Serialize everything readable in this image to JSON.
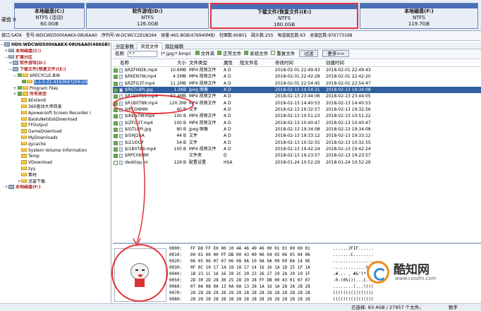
{
  "disk": {
    "label": "硬盘 0"
  },
  "partitions": [
    {
      "name": "本地磁盘(C:)",
      "fs": "NTFS (活动)",
      "size": "60.0GB",
      "selected": false
    },
    {
      "name": "软件游戏(D:)",
      "fs": "NTFS",
      "size": "126.0GB",
      "selected": false
    },
    {
      "name": "下载文件(恢复文件)(E:)",
      "fs": "NTFS",
      "size": "160.0GB",
      "selected": true
    },
    {
      "name": "本地磁盘(F:)",
      "fs": "NTFS",
      "size": "119.7GB",
      "selected": false
    }
  ],
  "info": [
    "接口:SATA",
    "型号:WDCWD5000AAKX-08U6AA0",
    "序列号:W-DCWCC2EU8264",
    "容量:465.8GB(476940MB)",
    "柱面数:60801",
    "磁头数:255",
    "每道扇区数:63",
    "总扇区数:976773168"
  ],
  "tree": [
    {
      "label": "HD0:WDCWD5000AAKX-08U6AA0(466GB)",
      "expander": "-",
      "checkbox": false,
      "icon": "drive",
      "style": "bold"
    },
    {
      "label": "本地磁盘(C:)",
      "expander": "+",
      "checkbox": false,
      "icon": "drive",
      "style": "red"
    },
    {
      "label": "扩展分区",
      "expander": "-",
      "checkbox": false,
      "icon": "drive",
      "style": "red"
    },
    {
      "label": "软件游戏(D:)",
      "expander": "+",
      "checkbox": false,
      "icon": "drive",
      "style": "red"
    },
    {
      "label": "下载文件(恢复文件)(E:)",
      "expander": "-",
      "checkbox": false,
      "icon": "drive",
      "style": "red"
    },
    {
      "label": "$RECYCLE.BIN",
      "expander": "-",
      "checkbox": true,
      "icon": "folder",
      "style": ""
    },
    {
      "label": "S-1-5-21-4163647256-24",
      "expander": "",
      "checkbox": true,
      "icon": "folder",
      "style": "hl"
    },
    {
      "label": "Program Files",
      "expander": "+",
      "checkbox": true,
      "icon": "folder",
      "style": ""
    },
    {
      "label": "所有类型",
      "expander": "+",
      "checkbox": true,
      "icon": "folder",
      "style": "red"
    },
    {
      "label": "$Extend",
      "expander": "",
      "checkbox": false,
      "icon": "folder",
      "style": ""
    },
    {
      "label": "360驱动大师目录",
      "expander": "",
      "checkbox": false,
      "icon": "folder",
      "style": ""
    },
    {
      "label": "Apowersoft Screen Recorder I",
      "expander": "",
      "checkbox": false,
      "icon": "folder",
      "style": ""
    },
    {
      "label": "BaiduNetdiskDownload",
      "expander": "",
      "checkbox": false,
      "icon": "folder",
      "style": ""
    },
    {
      "label": "FFOutput",
      "expander": "",
      "checkbox": false,
      "icon": "folder",
      "style": ""
    },
    {
      "label": "GameDownload",
      "expander": "",
      "checkbox": false,
      "icon": "folder",
      "style": ""
    },
    {
      "label": "MyDownloads",
      "expander": "",
      "checkbox": false,
      "icon": "folder",
      "style": ""
    },
    {
      "label": "qycache",
      "expander": "",
      "checkbox": false,
      "icon": "folder",
      "style": ""
    },
    {
      "label": "System Volume Information",
      "expander": "",
      "checkbox": false,
      "icon": "folder",
      "style": ""
    },
    {
      "label": "Temp",
      "expander": "",
      "checkbox": false,
      "icon": "folder",
      "style": ""
    },
    {
      "label": "VDownload",
      "expander": "",
      "checkbox": false,
      "icon": "folder",
      "style": ""
    },
    {
      "label": "zyy",
      "expander": "",
      "checkbox": false,
      "icon": "folder",
      "style": ""
    },
    {
      "label": "素材",
      "expander": "",
      "checkbox": false,
      "icon": "folder",
      "style": ""
    },
    {
      "label": "迅雷下载",
      "expander": "+",
      "checkbox": false,
      "icon": "folder",
      "style": ""
    },
    {
      "label": "本地磁盘(F:)",
      "expander": "+",
      "checkbox": false,
      "icon": "drive",
      "style": "red"
    }
  ],
  "tabs": [
    "分区参数",
    "浏览文件",
    "扇区编辑"
  ],
  "filter": {
    "name_label": "名称",
    "pattern": "*.*",
    "hint": "(*.jpg;*.bmp)",
    "checks": [
      {
        "label": "文件夹",
        "on": true
      },
      {
        "label": "正常文件",
        "on": true
      },
      {
        "label": "系统文件",
        "on": true
      },
      {
        "label": "重复文件",
        "on": false
      }
    ],
    "filter_btn": "过滤",
    "more_btn": "更多>>"
  },
  "columns": {
    "name": "名称",
    "size": "大小",
    "type": "文件类型",
    "attr": "属性",
    "short": "短文件名",
    "modified": "修改时间",
    "created": "创建时间"
  },
  "files": [
    {
      "name": "$RZFHIDK.mp4",
      "size": "10.6MB",
      "type": "MP4 视频文件",
      "attr": "A D",
      "short": "",
      "modified": "2018-02-01 22:49:43",
      "created": "2018-02-01 22:49:43",
      "checked": true,
      "selected": false
    },
    {
      "name": "$RKEN7W.mp4",
      "size": "4.5MB",
      "type": "MP4 视频文件",
      "attr": "A D",
      "short": "",
      "modified": "2018-02-01 22:42:28",
      "created": "2018-02-01 22:42:20",
      "checked": true,
      "selected": false
    },
    {
      "name": "$RZFG3T.mp4",
      "size": "11.1MB",
      "type": "MP4 视频文件",
      "attr": "A D",
      "short": "",
      "modified": "2018-02-01 22:54:45",
      "created": "2018-02-01 22:54:47",
      "checked": true,
      "selected": false
    },
    {
      "name": "$RGTL8PI.jpg",
      "size": "1.2KB",
      "type": "Jpeg 图像",
      "attr": "A D",
      "short": "",
      "modified": "2018-02-13 10:54:31",
      "created": "2018-02-13 19:34:08",
      "checked": true,
      "selected": true
    },
    {
      "name": "$R1B0T89.mp4",
      "size": "50.4MB",
      "type": "MP4 视频文件",
      "attr": "A D",
      "short": "",
      "modified": "2018-02-13 23:44:06",
      "created": "2018-02-13 23:44:05",
      "checked": true,
      "selected": false
    },
    {
      "name": "$R1B0T88.mp4",
      "size": "120.3MB",
      "type": "MP4 视频文件",
      "attr": "A D",
      "short": "",
      "modified": "2018-02-13 14:40:53",
      "created": "2018-02-13 14:40:53",
      "checked": true,
      "selected": false
    },
    {
      "name": "$IPCO6MM",
      "size": "40 B",
      "type": "文件",
      "attr": "A D",
      "short": "",
      "modified": "2018-02-13 19:32:57",
      "created": "2018-02-13 19:32:56",
      "checked": true,
      "selected": false
    },
    {
      "name": "$IKEN7W.mp4",
      "size": "100 B",
      "type": "MP4 视频文件",
      "attr": "A D",
      "short": "",
      "modified": "2018-02-13 10:51:23",
      "created": "2018-02-13 10:51:22",
      "checked": true,
      "selected": false
    },
    {
      "name": "$IZFG3T.mp4",
      "size": "100 B",
      "type": "MP4 视频文件",
      "attr": "A D",
      "short": "",
      "modified": "2018-02-13 10:40:47",
      "created": "2018-02-13 10:40:47",
      "checked": true,
      "selected": false
    },
    {
      "name": "$IGTL8PI.jpg",
      "size": "80 B",
      "type": "Jpeg 图像",
      "attr": "A D",
      "short": "",
      "modified": "2018-02-13 19:34:08",
      "created": "2018-02-13 19:34:08",
      "checked": true,
      "selected": false
    },
    {
      "name": "$I5HJ2AA",
      "size": "44 B",
      "type": "文件",
      "attr": "A D",
      "short": "",
      "modified": "2018-02-13 19:33:12",
      "created": "2018-02-13 19:33:12",
      "checked": true,
      "selected": false
    },
    {
      "name": "$I21I0OF",
      "size": "54 B",
      "type": "文件",
      "attr": "A D",
      "short": "",
      "modified": "2018-02-13 10:32:55",
      "created": "2018-02-13 10:32:55",
      "checked": true,
      "selected": false
    },
    {
      "name": "$I1B0T89.mp4",
      "size": "100 B",
      "type": "MP4 视频文件",
      "attr": "A D",
      "short": "",
      "modified": "2018-02-13 19:42:24",
      "created": "2018-02-13 19:42:24",
      "checked": true,
      "selected": false
    },
    {
      "name": "$RPC06MM",
      "size": "",
      "type": "文件夹",
      "attr": "D",
      "short": "",
      "modified": "2018-02-13 19:23:57",
      "created": "2018-02-13 19:23:57",
      "checked": true,
      "selected": false
    },
    {
      "name": "desktop.ini",
      "size": "129 B",
      "type": "配置设置",
      "attr": "HSA",
      "short": "",
      "modified": "2018-01-24 10:52:29",
      "created": "2018-01-24 10:52:29",
      "checked": false,
      "selected": false
    }
  ],
  "hex": [
    {
      "off": "0000:",
      "bytes": "FF D8 FF E0 00 10 4A 46 49 46 00 01 01 00 00 01",
      "ascii": "......JFIF......"
    },
    {
      "off": "0010:",
      "bytes": "00 01 00 00 FF DB 00 43 00 06 04 05 06 05 04 06",
      "ascii": ".......C........"
    },
    {
      "off": "0020:",
      "bytes": "06 05 06 07 07 06 08 0A 10 0A 0A 09 09 0A 14 0E",
      "ascii": "................"
    },
    {
      "off": "0030:",
      "bytes": "0F 0C 10 17 14 18 18 17 14 16 16 1A 1D 25 1F 1A",
      "ascii": ".............%.."
    },
    {
      "off": "0040:",
      "bytes": "1B 23 1C 16 16 20 2C 20 23 26 27 29 2A 29 19 1F",
      "ascii": ".#... , #&')*).."
    },
    {
      "off": "0050:",
      "bytes": "2D 30 2D 28 30 25 28 29 28 FF DB 00 43 01 07 07",
      "ascii": "-0-(0%()(...C..."
    },
    {
      "off": "0060:",
      "bytes": "07 0A 08 0A 13 0A 0A 13 28 1A 16 1A 28 28 28 28",
      "ascii": "........(...(((("
    },
    {
      "off": "0070:",
      "bytes": "28 28 28 28 28 28 28 28 28 28 28 28 28 28 28 28",
      "ascii": "(((((((((((((((("
    },
    {
      "off": "0080:",
      "bytes": "28 28 28 28 28 28 28 28 28 28 28 28 28 28 28 28",
      "ascii": "(((((((((((((((("
    }
  ],
  "status": {
    "selected": "已选择: 83.4GB / 27957 个文件。",
    "mode": "数字"
  },
  "watermark": {
    "brand": "酷知网",
    "url": "www.coozhi.com"
  },
  "colors": {
    "highlight": "#e5323a",
    "selection": "#2f5f9e",
    "partition_top": "#4a6fb8"
  }
}
